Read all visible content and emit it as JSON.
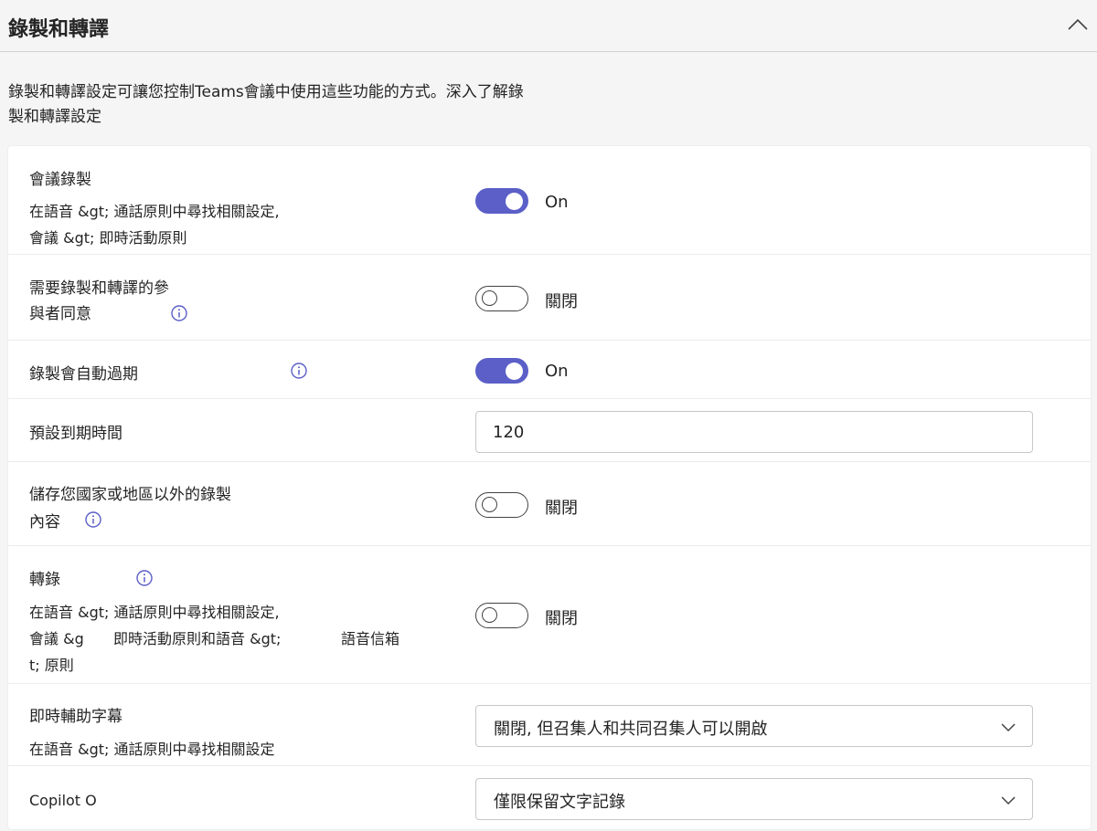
{
  "header": {
    "title": "錄製和轉譯"
  },
  "description": {
    "line1": "錄製和轉譯設定可讓您控制Teams會議中使用這些功能的方式。深入了解錄",
    "line2": "製和轉譯設定"
  },
  "settings": {
    "meeting_recording": {
      "label": "會議錄製",
      "sub1": "在語音 &gt; 通話原則中尋找相關設定,",
      "sub2": "會議 &gt;      即時活動原則",
      "state": "On"
    },
    "consent": {
      "label1": "需要錄製和轉譯的參",
      "label2": "與者同意",
      "state": "關閉"
    },
    "auto_expire": {
      "label": "錄製會自動過期",
      "state": "On"
    },
    "default_expiry": {
      "label": "預設到期時間",
      "value": "120"
    },
    "store_outside": {
      "label1": "儲存您國家或地區以外的錄製",
      "label2": "內容",
      "state": "關閉"
    },
    "transcription": {
      "label": "轉錄",
      "sub1": "在語音 &gt; 通話原則中尋找相關設定,",
      "sub2a": "會議 &g",
      "sub2b": "即時活動原則和語音 &gt;",
      "sub2c": "語音信箱",
      "sub3": "t; 原則",
      "state": "關閉"
    },
    "live_captions": {
      "label": "即時輔助字幕",
      "sub": "在語音 &gt; 通話原則中尋找相關設定",
      "selected": "關閉, 但召集人和共同召集人可以開啟"
    },
    "copilot": {
      "label": "Copilot O",
      "selected": "僅限保留文字記錄"
    }
  },
  "colors": {
    "accent": "#5b5fc7",
    "background": "#f5f5f5",
    "card": "#ffffff"
  }
}
